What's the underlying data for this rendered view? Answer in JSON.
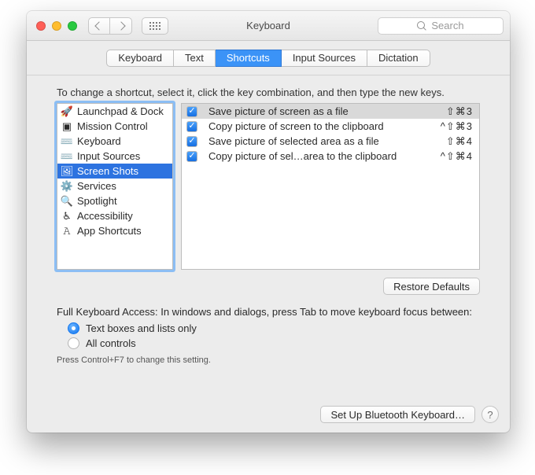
{
  "window": {
    "title": "Keyboard"
  },
  "search": {
    "placeholder": "Search"
  },
  "tabs": [
    "Keyboard",
    "Text",
    "Shortcuts",
    "Input Sources",
    "Dictation"
  ],
  "active_tab_index": 2,
  "intro": "To change a shortcut, select it, click the key combination, and then type the new keys.",
  "categories": [
    {
      "icon": "🚀",
      "label": "Launchpad & Dock"
    },
    {
      "icon": "▣",
      "label": "Mission Control"
    },
    {
      "icon": "⌨️",
      "label": "Keyboard"
    },
    {
      "icon": "⌨️",
      "label": "Input Sources"
    },
    {
      "icon": "🖼",
      "label": "Screen Shots"
    },
    {
      "icon": "⚙️",
      "label": "Services"
    },
    {
      "icon": "🔍",
      "label": "Spotlight"
    },
    {
      "icon": "♿︎",
      "label": "Accessibility"
    },
    {
      "icon": "𝙰",
      "label": "App Shortcuts"
    }
  ],
  "selected_category_index": 4,
  "shortcuts": [
    {
      "checked": true,
      "label": "Save picture of screen as a file",
      "keys": "⇧⌘3"
    },
    {
      "checked": true,
      "label": "Copy picture of screen to the clipboard",
      "keys": "^⇧⌘3"
    },
    {
      "checked": true,
      "label": "Save picture of selected area as a file",
      "keys": "⇧⌘4"
    },
    {
      "checked": true,
      "label": "Copy picture of sel…area to the clipboard",
      "keys": "^⇧⌘4"
    }
  ],
  "selected_shortcut_index": 0,
  "buttons": {
    "restore_defaults": "Restore Defaults",
    "bluetooth": "Set Up Bluetooth Keyboard…"
  },
  "full_keyboard_access": {
    "prompt": "Full Keyboard Access: In windows and dialogs, press Tab to move keyboard focus between:",
    "options": [
      "Text boxes and lists only",
      "All controls"
    ],
    "selected": 0,
    "hint": "Press Control+F7 to change this setting."
  }
}
